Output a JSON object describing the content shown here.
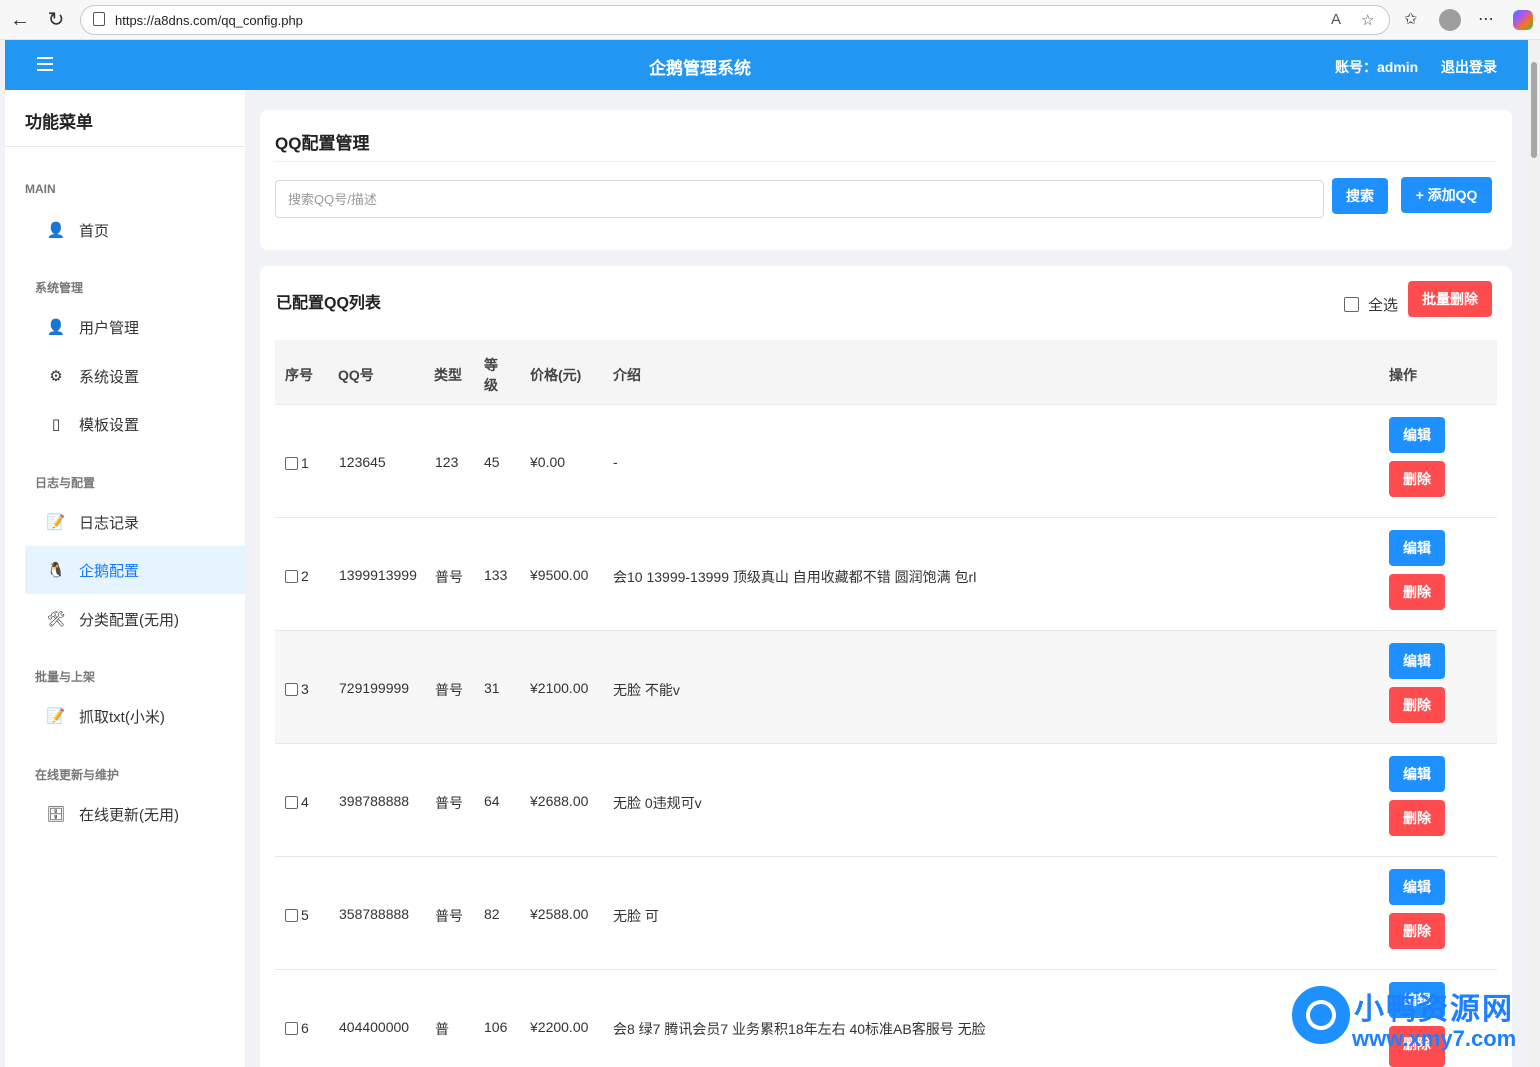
{
  "browser": {
    "url": "https://a8dns.com/qq_config.php"
  },
  "header": {
    "title": "企鹅管理系统",
    "account": "账号：admin",
    "logout": "退出登录"
  },
  "sidebar": {
    "title": "功能菜单",
    "sections": [
      {
        "label": "MAIN",
        "items": [
          {
            "label": "首页",
            "icon": "user-icon"
          }
        ]
      },
      {
        "label": "系统管理",
        "items": [
          {
            "label": "用户管理",
            "icon": "user-icon"
          },
          {
            "label": "系统设置",
            "icon": "gear-icon"
          },
          {
            "label": "模板设置",
            "icon": "template-icon"
          }
        ]
      },
      {
        "label": "日志与配置",
        "items": [
          {
            "label": "日志记录",
            "icon": "memo-icon"
          },
          {
            "label": "企鹅配置",
            "icon": "penguin-icon",
            "active": true
          },
          {
            "label": "分类配置(无用)",
            "icon": "tools-icon"
          }
        ]
      },
      {
        "label": "批量与上架",
        "items": [
          {
            "label": "抓取txt(小米)",
            "icon": "memo-icon"
          }
        ]
      },
      {
        "label": "在线更新与维护",
        "items": [
          {
            "label": "在线更新(无用)",
            "icon": "cabinet-icon"
          }
        ]
      }
    ]
  },
  "config_card": {
    "title": "QQ配置管理",
    "search_placeholder": "搜索QQ号/描述",
    "search_button": "搜索",
    "add_button": "+ 添加QQ"
  },
  "list_card": {
    "title": "已配置QQ列表",
    "select_all": "全选",
    "batch_delete": "批量删除",
    "columns": {
      "index": "序号",
      "qq": "QQ号",
      "type": "类型",
      "level_1": "等",
      "level_2": "级",
      "price": "价格(元)",
      "desc": "介绍",
      "action": "操作"
    },
    "edit_label": "编辑",
    "delete_label": "删除",
    "rows": [
      {
        "index": "1",
        "qq": "123645",
        "type": "123",
        "level": "45",
        "price": "¥0.00",
        "desc": "-"
      },
      {
        "index": "2",
        "qq": "1399913999",
        "type": "普号",
        "level": "133",
        "price": "¥9500.00",
        "desc": "会10 13999-13999 顶级真山 自用收藏都不错 圆润饱满 包rl"
      },
      {
        "index": "3",
        "qq": "729199999",
        "type": "普号",
        "level": "31",
        "price": "¥2100.00",
        "desc": "无脸 不能v"
      },
      {
        "index": "4",
        "qq": "398788888",
        "type": "普号",
        "level": "64",
        "price": "¥2688.00",
        "desc": "无脸 0违规可v"
      },
      {
        "index": "5",
        "qq": "358788888",
        "type": "普号",
        "level": "82",
        "price": "¥2588.00",
        "desc": "无脸 可"
      },
      {
        "index": "6",
        "qq": "404400000",
        "type": "普",
        "level": "106",
        "price": "¥2200.00",
        "desc": "会8 绿7 腾讯会员7 业务累积18年左右 40标准AB客服号 无脸"
      }
    ]
  },
  "watermark": {
    "title": "小鸭资源网",
    "url": "www.xmy7.com"
  },
  "colors": {
    "primary": "#2196f3",
    "danger": "#ff4d4f",
    "active_bg": "#e6f4ff"
  }
}
